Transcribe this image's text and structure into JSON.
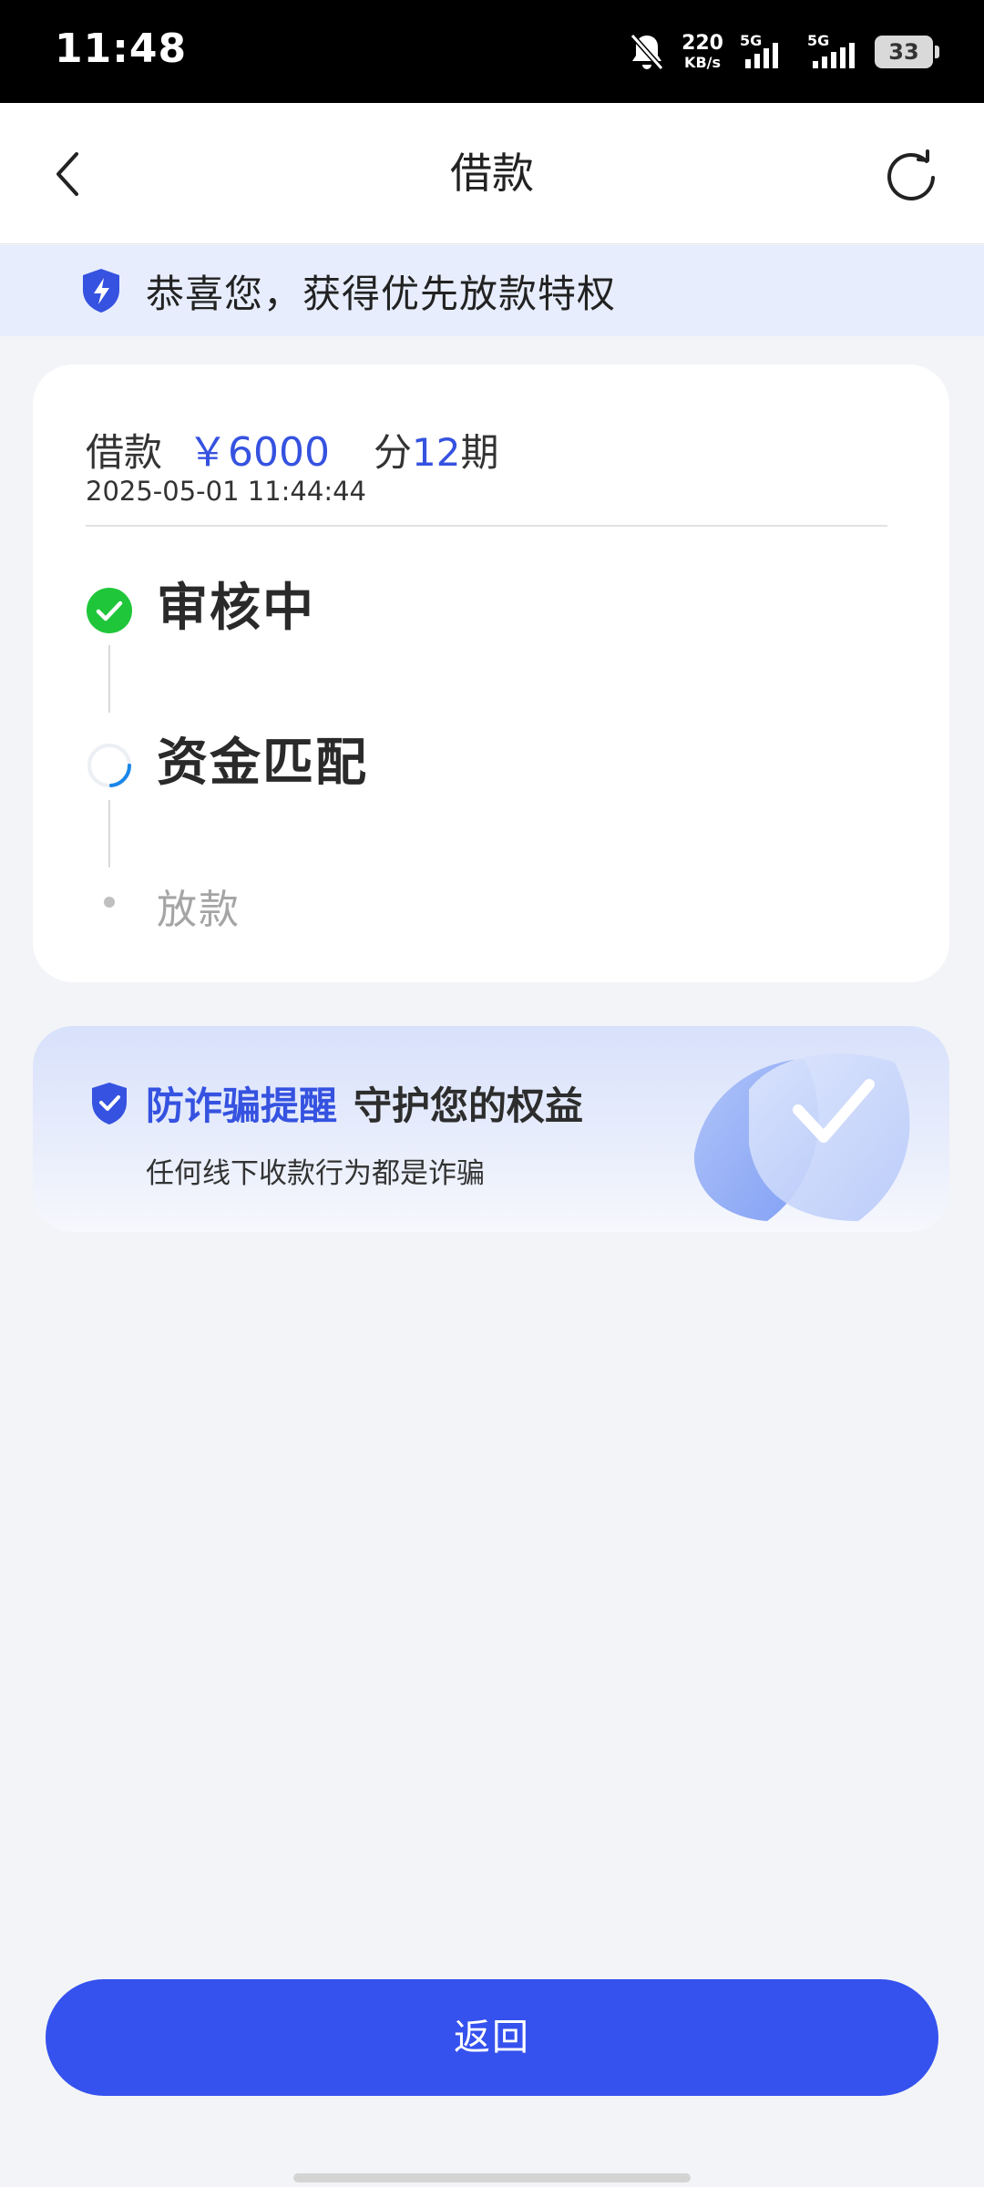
{
  "status_bar": {
    "time": "11:48",
    "net_speed": "220",
    "net_unit": "KB/s",
    "sim1_label": "5G",
    "sim2_label": "5G",
    "battery": "33"
  },
  "nav": {
    "title": "借款",
    "back_icon": "chevron-left-icon",
    "refresh_icon": "refresh-icon"
  },
  "banner": {
    "text": "恭喜您，获得优先放款特权",
    "icon": "shield-lightning-icon"
  },
  "loan": {
    "label": "借款",
    "amount": "￥6000",
    "term_prefix": "分",
    "term_count": "12",
    "term_suffix": "期",
    "datetime": "2025-05-01 11:44:44"
  },
  "steps": [
    {
      "label": "审核中",
      "state": "done"
    },
    {
      "label": "资金匹配",
      "state": "in-progress"
    },
    {
      "label": "放款",
      "state": "pending"
    }
  ],
  "fraud": {
    "title": "防诈骗提醒",
    "subtitle": "守护您的权益",
    "note": "任何线下收款行为都是诈骗",
    "icon": "shield-check-icon"
  },
  "actions": {
    "return_label": "返回"
  },
  "colors": {
    "accent": "#3552e0",
    "button": "#3551ee",
    "success": "#1fc63a",
    "banner_bg": "#e7edfd"
  }
}
